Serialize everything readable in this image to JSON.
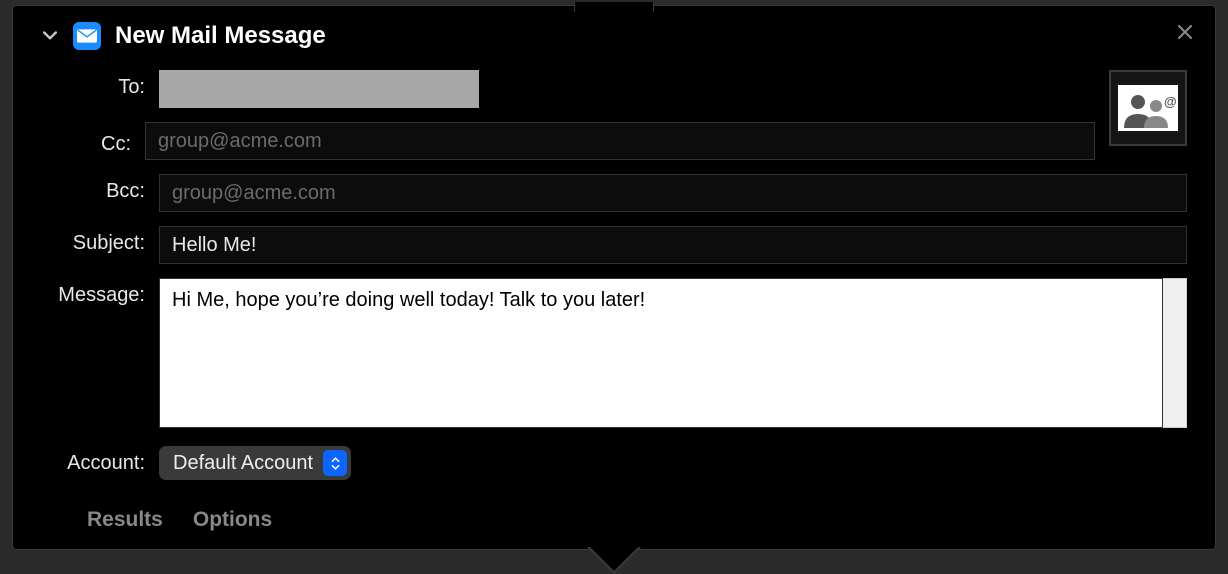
{
  "title": "New Mail Message",
  "labels": {
    "to": "To:",
    "cc": "Cc:",
    "bcc": "Bcc:",
    "subject": "Subject:",
    "message": "Message:",
    "account": "Account:"
  },
  "fields": {
    "to_value": "",
    "cc_placeholder": "group@acme.com",
    "cc_value": "",
    "bcc_placeholder": "group@acme.com",
    "bcc_value": "",
    "subject_value": "Hello Me!",
    "message_value": "Hi Me, hope you’re doing well today! Talk to you later!"
  },
  "account": {
    "selected": "Default Account"
  },
  "footer": {
    "results": "Results",
    "options": "Options"
  }
}
